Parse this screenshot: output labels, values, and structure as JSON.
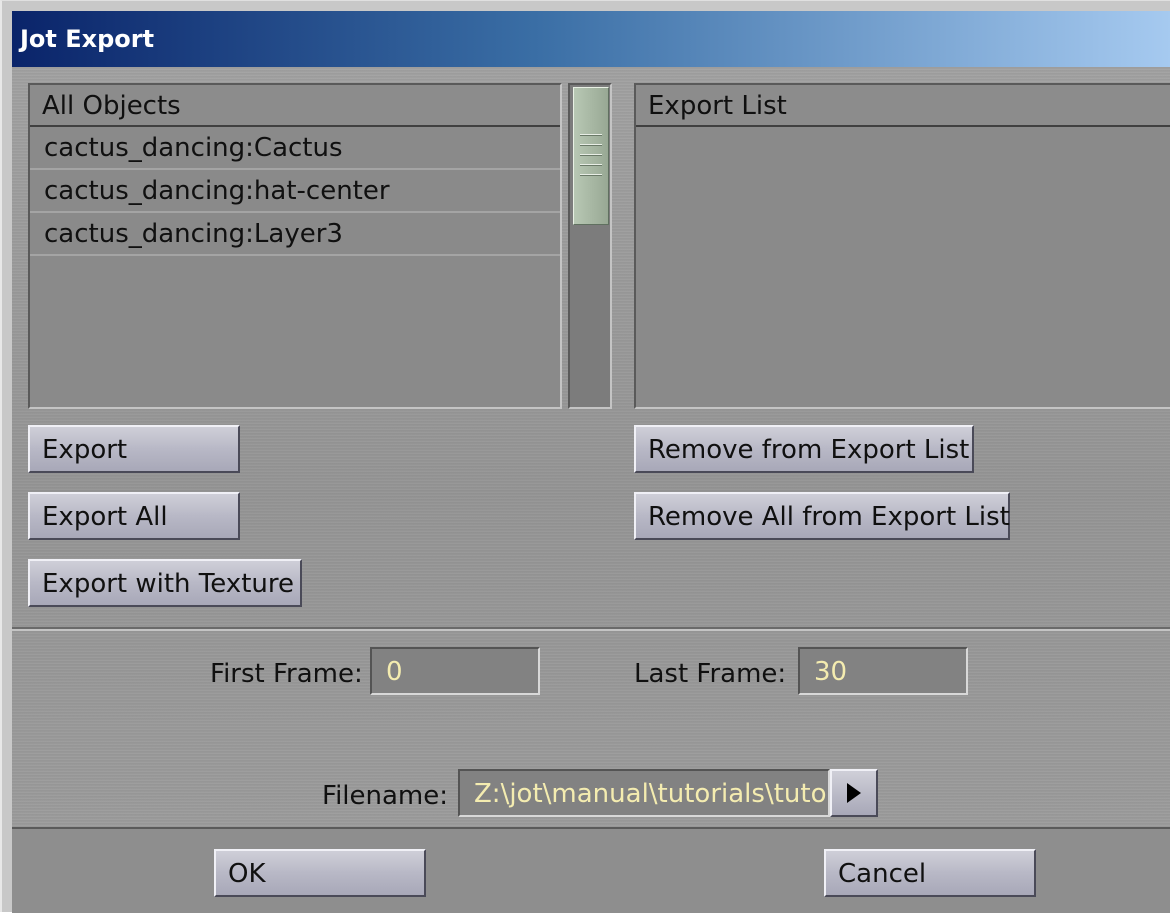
{
  "window": {
    "title": "Jot Export"
  },
  "all_objects": {
    "header": "All Objects",
    "items": [
      "cactus_dancing:Cactus",
      "cactus_dancing:hat-center",
      "cactus_dancing:Layer3"
    ]
  },
  "export_list": {
    "header": "Export List",
    "items": []
  },
  "buttons": {
    "export": "Export",
    "export_all": "Export All",
    "export_with_texture": "Export with Texture",
    "remove_from_export_list": "Remove from Export List",
    "remove_all_from_export_list": "Remove All from Export List",
    "ok": "OK",
    "cancel": "Cancel"
  },
  "frames": {
    "first_label": "First Frame:",
    "first_value": "0",
    "last_label": "Last Frame:",
    "last_value": "30"
  },
  "filename": {
    "label": "Filename:",
    "value": "Z:\\jot\\manual\\tutorials\\tutor",
    "browse_icon": "play-right-icon"
  },
  "colors": {
    "title_gradient_start": "#0a246a",
    "title_gradient_end": "#a6caf0",
    "field_text": "#f4ecb0",
    "panel_bg": "#8a8a8a"
  }
}
